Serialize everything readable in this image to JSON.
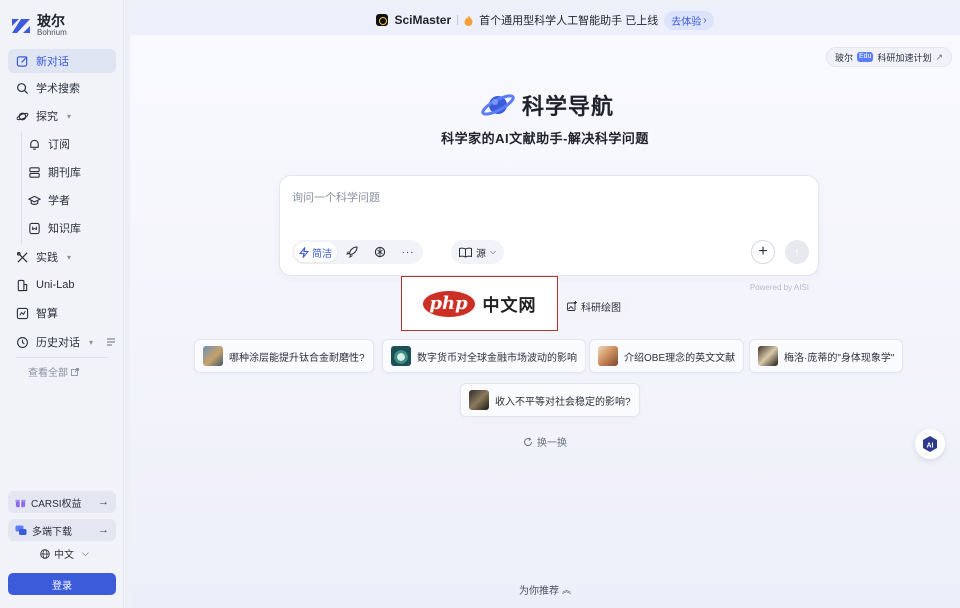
{
  "sidebar": {
    "logo": {
      "cn": "玻尔",
      "en": "Bohrium"
    },
    "items": [
      {
        "label": "新对话",
        "icon": "new-chat-icon"
      },
      {
        "label": "学术搜索",
        "icon": "search-icon"
      },
      {
        "label": "探究",
        "icon": "planet-icon"
      },
      {
        "label": "订阅",
        "icon": "bell-icon"
      },
      {
        "label": "期刊库",
        "icon": "journal-icon"
      },
      {
        "label": "学者",
        "icon": "graduation-cap-icon"
      },
      {
        "label": "知识库",
        "icon": "knowledge-base-icon"
      },
      {
        "label": "实践",
        "icon": "tools-icon"
      },
      {
        "label": "Uni-Lab",
        "icon": "lab-icon"
      },
      {
        "label": "智算",
        "icon": "compute-icon"
      },
      {
        "label": "历史对话",
        "icon": "history-icon"
      }
    ],
    "view_all": "查看全部",
    "carsi": "CARSI权益",
    "download": "多端下载",
    "language": "中文",
    "login": "登录"
  },
  "banner": {
    "product": "SciMaster",
    "text": "首个通用型科学人工智能助手 已上线",
    "cta": "去体验"
  },
  "edu": {
    "prefix": "玻尔",
    "badge": "Edu",
    "text": "科研加速计划"
  },
  "hero": {
    "title": "科学导航",
    "subtitle": "科学家的AI文献助手-解决科学问题"
  },
  "search": {
    "placeholder": "询问一个科学问题",
    "mode_label": "简洁",
    "source_label": "源",
    "powered": "Powered by AISI"
  },
  "ad": {
    "logo": "php",
    "text": "中文网"
  },
  "draw_button": "科研绘图",
  "suggestions": [
    "哪种涂层能提升钛合金耐磨性?",
    "数字货币对全球金融市场波动的影响",
    "介绍OBE理念的英文文献",
    "梅洛·庞蒂的\"身体现象学\"",
    "收入不平等对社会稳定的影响?"
  ],
  "refresh": "换一换",
  "recommend": "为你推荐",
  "colors": {
    "accent": "#3b5bdb",
    "ad_red": "#cc2f24"
  }
}
